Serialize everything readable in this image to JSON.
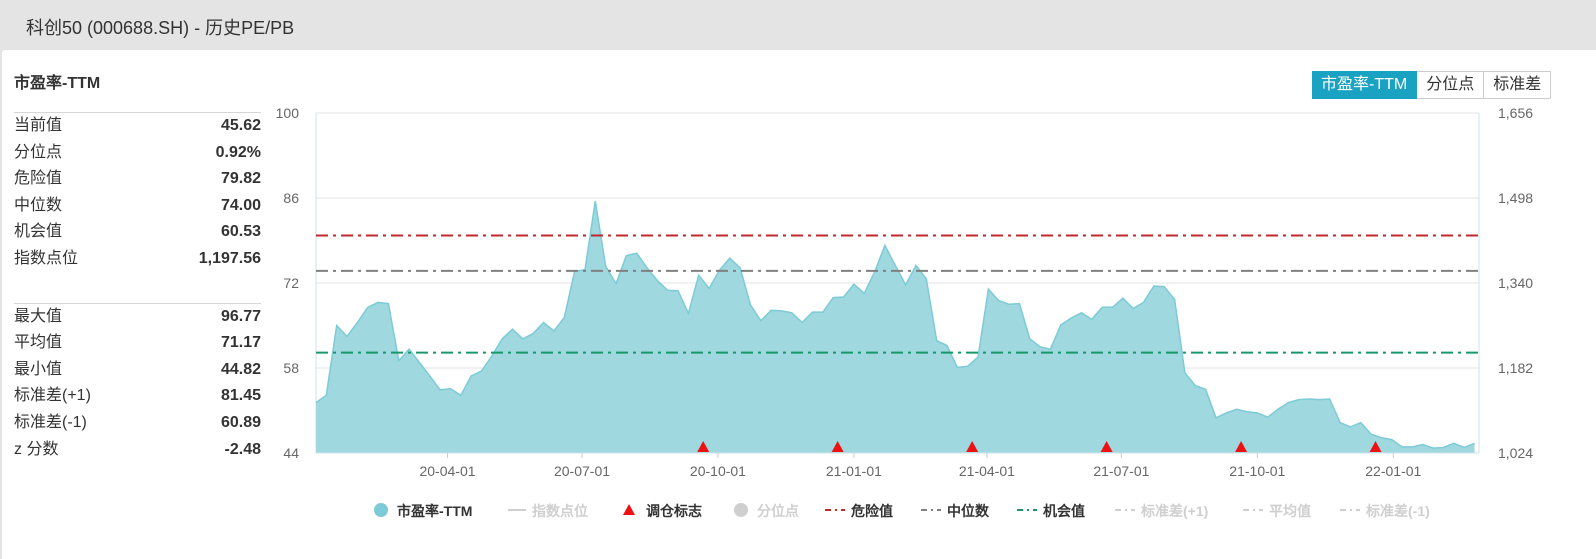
{
  "window": {
    "title": "科创50 (000688.SH) - 历史PE/PB"
  },
  "stats": {
    "title": "市盈率-TTM",
    "group1": [
      {
        "label": "当前值",
        "value": "45.62"
      },
      {
        "label": "分位点",
        "value": "0.92%"
      },
      {
        "label": "危险值",
        "value": "79.82"
      },
      {
        "label": "中位数",
        "value": "74.00"
      },
      {
        "label": "机会值",
        "value": "60.53"
      },
      {
        "label": "指数点位",
        "value": "1,197.56"
      }
    ],
    "group2": [
      {
        "label": "最大值",
        "value": "96.77"
      },
      {
        "label": "平均值",
        "value": "71.17"
      },
      {
        "label": "最小值",
        "value": "44.82"
      },
      {
        "label": "标准差(+1)",
        "value": "81.45"
      },
      {
        "label": "标准差(-1)",
        "value": "60.89"
      },
      {
        "label": "z 分数",
        "value": "-2.48"
      }
    ]
  },
  "tabs": [
    "市盈率-TTM",
    "分位点",
    "标准差"
  ],
  "active_tab": 0,
  "colors": {
    "area_fill": "#9fd8df",
    "area_line": "#7ccbd6",
    "danger": "#c0282c",
    "median": "#808080",
    "opportunity": "#17976a",
    "marker": "#ee1111",
    "accent": "#19a2c2"
  },
  "chart_data": {
    "type": "area",
    "x_tick_labels": [
      "20-04-01",
      "20-07-01",
      "20-10-01",
      "21-01-01",
      "21-04-01",
      "21-07-01",
      "21-10-01",
      "22-01-01"
    ],
    "x_range": [
      "2020-01-03",
      "2022-02-28"
    ],
    "y_left": {
      "ticks": [
        "100",
        "86",
        "72",
        "58",
        "44"
      ],
      "ylim": [
        44,
        100
      ]
    },
    "y_right": {
      "ticks": [
        "1,656",
        "1,498",
        "1,340",
        "1,182",
        "1,024"
      ],
      "ylim": [
        1024,
        1656
      ]
    },
    "series": [
      {
        "name": "市盈率-TTM",
        "points": [
          [
            "2020-01-03",
            52.3
          ],
          [
            "2020-01-10",
            53.5
          ],
          [
            "2020-01-17",
            65.0
          ],
          [
            "2020-01-24",
            63.2
          ],
          [
            "2020-01-31",
            65.5
          ],
          [
            "2020-02-07",
            68.0
          ],
          [
            "2020-02-14",
            68.8
          ],
          [
            "2020-02-21",
            68.6
          ],
          [
            "2020-02-28",
            59.2
          ],
          [
            "2020-03-06",
            61.1
          ],
          [
            "2020-03-13",
            58.9
          ],
          [
            "2020-03-20",
            56.7
          ],
          [
            "2020-03-27",
            54.4
          ],
          [
            "2020-04-03",
            54.6
          ],
          [
            "2020-04-10",
            53.5
          ],
          [
            "2020-04-17",
            56.7
          ],
          [
            "2020-04-24",
            57.5
          ],
          [
            "2020-05-01",
            60.0
          ],
          [
            "2020-05-08",
            62.8
          ],
          [
            "2020-05-15",
            64.4
          ],
          [
            "2020-05-22",
            62.8
          ],
          [
            "2020-05-29",
            63.7
          ],
          [
            "2020-06-05",
            65.5
          ],
          [
            "2020-06-12",
            64.1
          ],
          [
            "2020-06-19",
            66.3
          ],
          [
            "2020-06-26",
            73.9
          ],
          [
            "2020-07-03",
            74.2
          ],
          [
            "2020-07-10",
            85.5
          ],
          [
            "2020-07-17",
            74.8
          ],
          [
            "2020-07-24",
            71.9
          ],
          [
            "2020-07-31",
            76.5
          ],
          [
            "2020-08-07",
            76.9
          ],
          [
            "2020-08-14",
            74.5
          ],
          [
            "2020-08-21",
            72.4
          ],
          [
            "2020-08-28",
            70.8
          ],
          [
            "2020-09-04",
            70.7
          ],
          [
            "2020-09-11",
            67.0
          ],
          [
            "2020-09-18",
            73.3
          ],
          [
            "2020-09-25",
            71.1
          ],
          [
            "2020-10-02",
            74.1
          ],
          [
            "2020-10-09",
            76.1
          ],
          [
            "2020-10-16",
            74.5
          ],
          [
            "2020-10-23",
            68.4
          ],
          [
            "2020-10-30",
            65.8
          ],
          [
            "2020-11-06",
            67.5
          ],
          [
            "2020-11-13",
            67.4
          ],
          [
            "2020-11-20",
            67.1
          ],
          [
            "2020-11-27",
            65.5
          ],
          [
            "2020-12-04",
            67.2
          ],
          [
            "2020-12-11",
            67.2
          ],
          [
            "2020-12-18",
            69.6
          ],
          [
            "2020-12-25",
            69.7
          ],
          [
            "2021-01-01",
            71.8
          ],
          [
            "2021-01-08",
            70.3
          ],
          [
            "2021-01-15",
            73.8
          ],
          [
            "2021-01-22",
            78.2
          ],
          [
            "2021-01-29",
            74.9
          ],
          [
            "2021-02-05",
            71.7
          ],
          [
            "2021-02-12",
            74.9
          ],
          [
            "2021-02-19",
            72.7
          ],
          [
            "2021-02-26",
            62.5
          ],
          [
            "2021-03-05",
            61.7
          ],
          [
            "2021-03-12",
            58.1
          ],
          [
            "2021-03-19",
            58.3
          ],
          [
            "2021-03-26",
            59.8
          ],
          [
            "2021-04-02",
            71.0
          ],
          [
            "2021-04-09",
            69.1
          ],
          [
            "2021-04-16",
            68.5
          ],
          [
            "2021-04-23",
            68.6
          ],
          [
            "2021-04-30",
            62.8
          ],
          [
            "2021-05-07",
            61.5
          ],
          [
            "2021-05-14",
            61.1
          ],
          [
            "2021-05-21",
            65.1
          ],
          [
            "2021-05-28",
            66.2
          ],
          [
            "2021-06-04",
            67.1
          ],
          [
            "2021-06-11",
            66.0
          ],
          [
            "2021-06-18",
            68.0
          ],
          [
            "2021-06-25",
            68.0
          ],
          [
            "2021-07-02",
            69.5
          ],
          [
            "2021-07-09",
            67.8
          ],
          [
            "2021-07-16",
            68.8
          ],
          [
            "2021-07-23",
            71.5
          ],
          [
            "2021-07-30",
            71.4
          ],
          [
            "2021-08-06",
            69.3
          ],
          [
            "2021-08-13",
            57.2
          ],
          [
            "2021-08-20",
            55.1
          ],
          [
            "2021-08-27",
            54.5
          ],
          [
            "2021-09-03",
            49.8
          ],
          [
            "2021-09-10",
            50.6
          ],
          [
            "2021-09-17",
            51.2
          ],
          [
            "2021-09-24",
            50.8
          ],
          [
            "2021-10-01",
            50.6
          ],
          [
            "2021-10-08",
            49.9
          ],
          [
            "2021-10-15",
            51.2
          ],
          [
            "2021-10-22",
            52.3
          ],
          [
            "2021-10-29",
            52.8
          ],
          [
            "2021-11-05",
            52.9
          ],
          [
            "2021-11-12",
            52.8
          ],
          [
            "2021-11-19",
            52.9
          ],
          [
            "2021-11-26",
            49.0
          ],
          [
            "2021-12-03",
            48.3
          ],
          [
            "2021-12-10",
            49.0
          ],
          [
            "2021-12-17",
            47.1
          ],
          [
            "2021-12-24",
            46.5
          ],
          [
            "2021-12-31",
            46.2
          ],
          [
            "2022-01-07",
            45.0
          ],
          [
            "2022-01-14",
            45.0
          ],
          [
            "2022-01-21",
            45.4
          ],
          [
            "2022-01-28",
            44.8
          ],
          [
            "2022-02-04",
            44.9
          ],
          [
            "2022-02-11",
            45.6
          ],
          [
            "2022-02-18",
            44.9
          ],
          [
            "2022-02-25",
            45.6
          ]
        ]
      }
    ],
    "reference_lines": [
      {
        "name": "危险值",
        "value": 79.82,
        "style": "dash-dot",
        "color": "#c0282c"
      },
      {
        "name": "中位数",
        "value": 74.0,
        "style": "dash-dot",
        "color": "#808080"
      },
      {
        "name": "机会值",
        "value": 60.53,
        "style": "dash-dot",
        "color": "#17976a"
      }
    ],
    "rebalance_markers": [
      "2020-09-21",
      "2020-12-21",
      "2021-03-22",
      "2021-06-21",
      "2021-09-20",
      "2021-12-20"
    ],
    "legend": {
      "placement": "bottom",
      "items": [
        {
          "label": "市盈率-TTM",
          "symbol": "circle",
          "color": "#7ccbd6",
          "active": true
        },
        {
          "label": "指数点位",
          "symbol": "line",
          "color": "#cfcfcf",
          "active": false
        },
        {
          "label": "调仓标志",
          "symbol": "triangle",
          "color": "#ee1111",
          "active": true
        },
        {
          "label": "分位点",
          "symbol": "circle",
          "color": "#cfcfcf",
          "active": false
        },
        {
          "label": "危险值",
          "symbol": "dashdot",
          "color": "#c0282c",
          "active": true
        },
        {
          "label": "中位数",
          "symbol": "dashdot",
          "color": "#808080",
          "active": true
        },
        {
          "label": "机会值",
          "symbol": "dashdot",
          "color": "#17976a",
          "active": true
        },
        {
          "label": "标准差(+1)",
          "symbol": "dashdot",
          "color": "#cfcfcf",
          "active": false
        },
        {
          "label": "平均值",
          "symbol": "dashdot",
          "color": "#cfcfcf",
          "active": false
        },
        {
          "label": "标准差(-1)",
          "symbol": "dashdot",
          "color": "#cfcfcf",
          "active": false
        }
      ]
    },
    "grid": true
  }
}
